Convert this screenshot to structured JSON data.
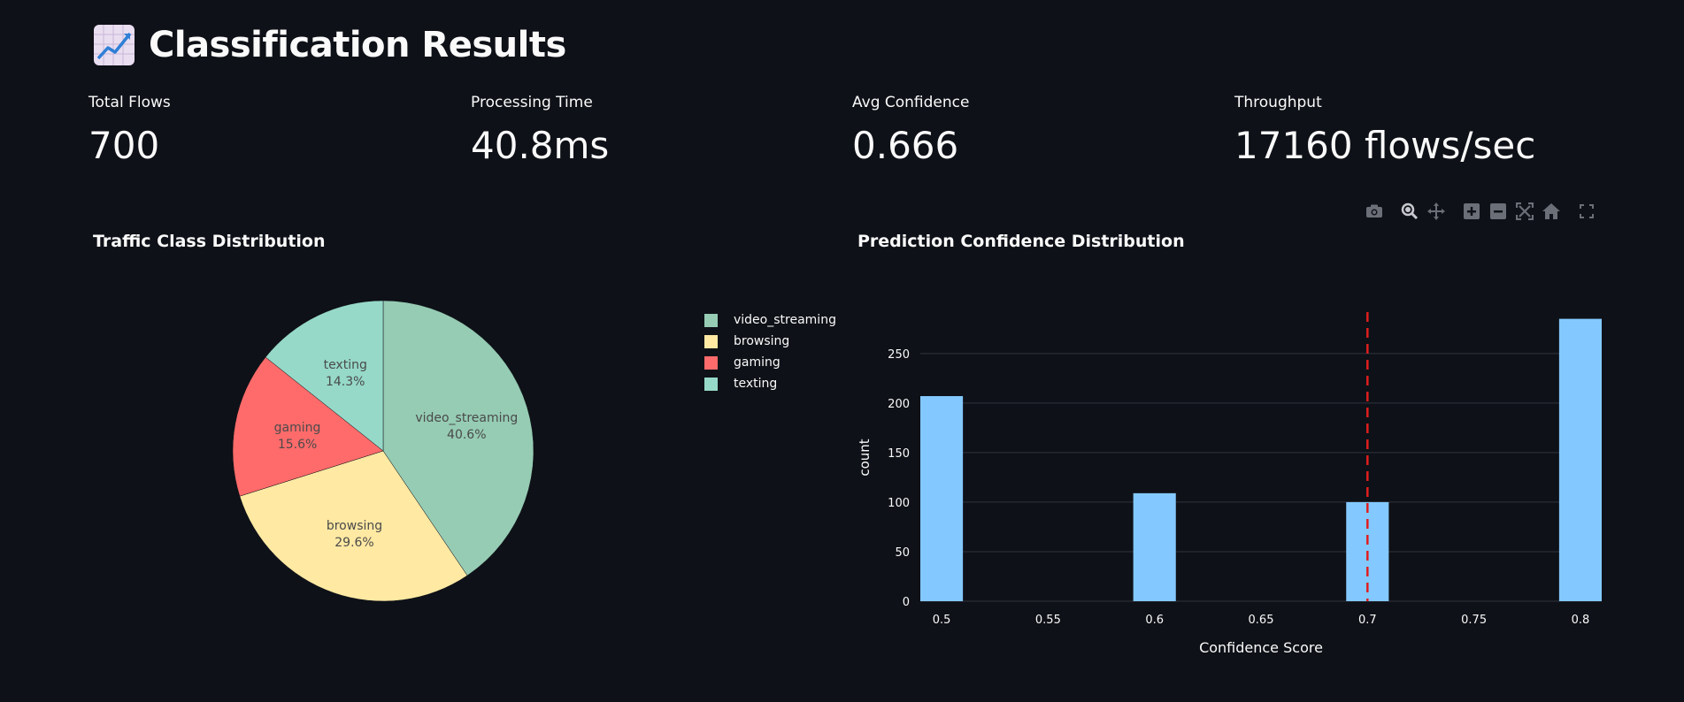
{
  "header": {
    "title": "Classification Results",
    "icon": "chart-increasing-icon"
  },
  "metrics": [
    {
      "label": "Total Flows",
      "value": "700"
    },
    {
      "label": "Processing Time",
      "value": "40.8ms"
    },
    {
      "label": "Avg Confidence",
      "value": "0.666"
    },
    {
      "label": "Throughput",
      "value": "17160 flows/sec"
    }
  ],
  "colors": {
    "background": "#0e1117",
    "video_streaming": "#96ccb4",
    "browsing": "#ffe9a3",
    "gaming": "#ff6b6b",
    "texting": "#96d9c8",
    "histogram_bar": "#83c9ff",
    "threshold_line": "#e01e1e"
  },
  "modebar": [
    "camera-icon",
    "zoom-icon",
    "pan-icon",
    "zoom-in-icon",
    "zoom-out-icon",
    "autoscale-icon",
    "reset-axes-icon",
    "fullscreen-icon"
  ],
  "chart_data": [
    {
      "type": "pie",
      "title": "Traffic Class Distribution",
      "categories": [
        "video_streaming",
        "browsing",
        "gaming",
        "texting"
      ],
      "values": [
        40.6,
        29.6,
        15.6,
        14.3
      ],
      "labels": [
        "video_streaming\n40.6%",
        "browsing\n29.6%",
        "gaming\n15.6%",
        "texting\n14.3%"
      ],
      "legend": "right"
    },
    {
      "type": "bar",
      "title": "Prediction Confidence Distribution",
      "xlabel": "Confidence Score",
      "ylabel": "count",
      "x": [
        0.5,
        0.6,
        0.7,
        0.8
      ],
      "values": [
        207,
        109,
        100,
        285
      ],
      "xlim": [
        0.49,
        0.81
      ],
      "ylim": [
        0,
        290
      ],
      "xticks": [
        "0.5",
        "0.55",
        "0.6",
        "0.65",
        "0.7",
        "0.75",
        "0.8"
      ],
      "yticks": [
        "0",
        "50",
        "100",
        "150",
        "200",
        "250"
      ],
      "threshold": 0.7,
      "grid": true
    }
  ]
}
